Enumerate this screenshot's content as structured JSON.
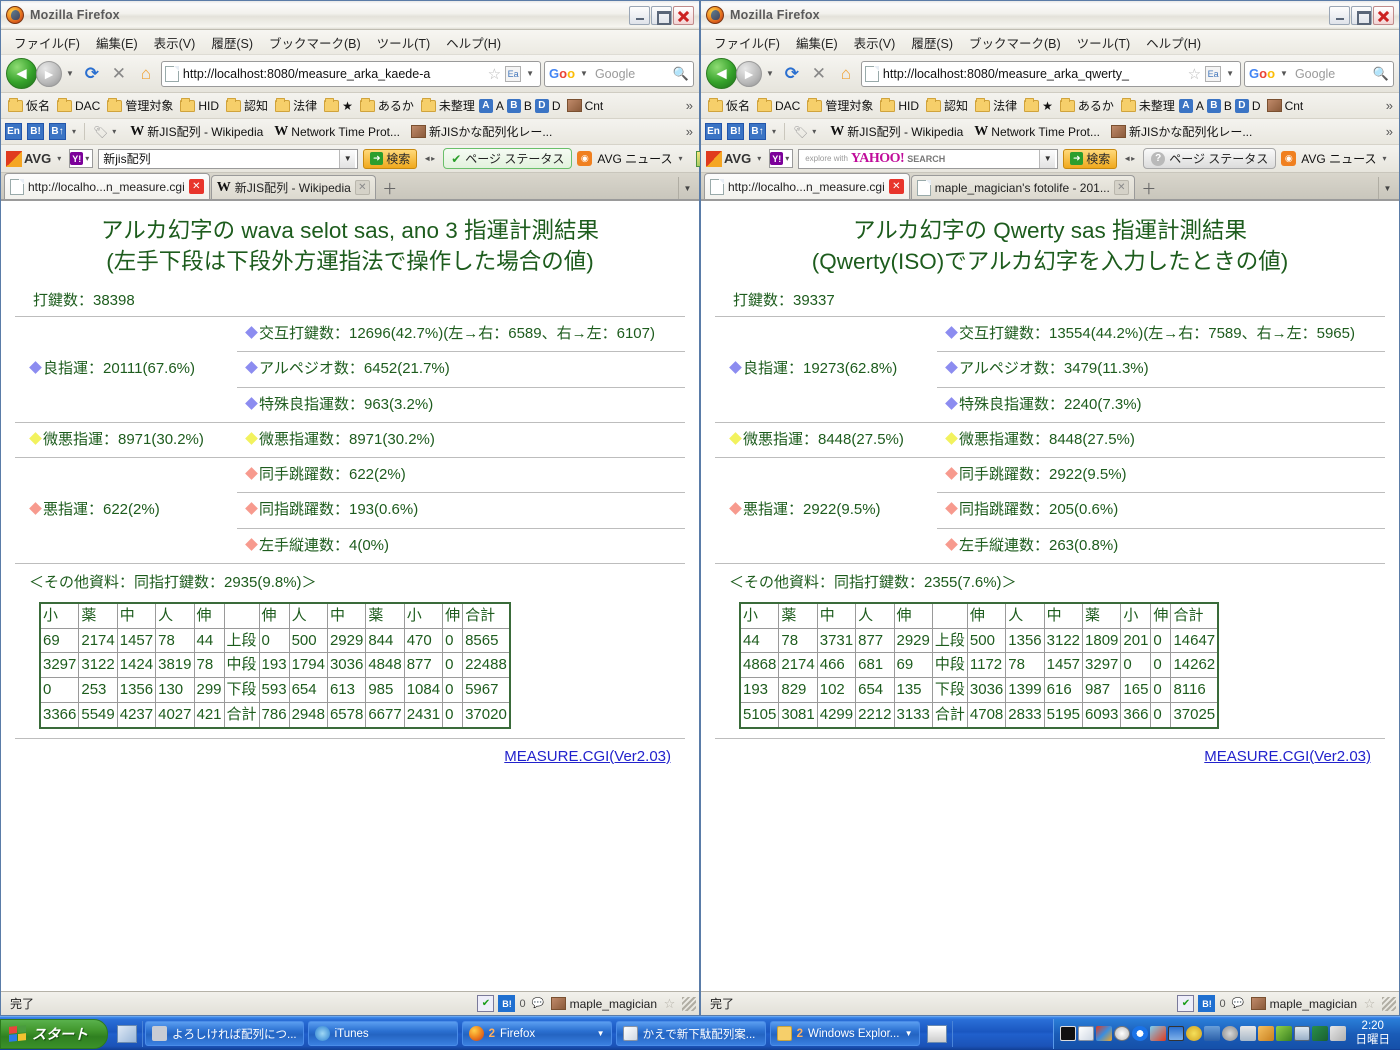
{
  "window": {
    "title": "Mozilla Firefox",
    "buttons": {
      "minimize": "_",
      "maximize": "□",
      "close": "✕"
    }
  },
  "menubar": [
    "ファイル(F)",
    "編集(E)",
    "表示(V)",
    "履歴(S)",
    "ブックマーク(B)",
    "ツール(T)",
    "ヘルプ(H)"
  ],
  "bookmarks_bar": {
    "folders": [
      "仮名",
      "DAC",
      "管理対象",
      "HID",
      "認知",
      "法律",
      "★",
      "あるか",
      "未整理"
    ],
    "chips": [
      "A",
      "A",
      "B",
      "B",
      "D",
      "D"
    ],
    "photo_label": "Cnt",
    "overflow": "»"
  },
  "bookmarks_bar2": {
    "icons": [
      "En",
      "B!",
      "B↑"
    ],
    "tag_arrow": "▾",
    "items": [
      "新JIS配列 - Wikipedia",
      "Network Time Prot...",
      "新JISかな配列化レー..."
    ],
    "overflow": "»"
  },
  "avg_bar": {
    "logo": "AVG",
    "dropdown_arrow": "▾",
    "search_button": "検索",
    "page_status": "ページ ステータス",
    "news": "AVG ニュース",
    "news_arrow": "▾"
  },
  "left": {
    "url": "http://localhost:8080/measure_arka_kaede-a",
    "search_placeholder": "Google",
    "avg_search_value": "新jis配列",
    "tabs": [
      {
        "label": "http://localho...n_measure.cgi",
        "active": true
      },
      {
        "label": "新JIS配列 - Wikipedia",
        "active": false
      }
    ],
    "page": {
      "title_line1": "アルカ幻字の wava selot sas, ano 3 指運計測結果",
      "title_line2": "(左手下段は下段外方運指法で操作した場合の値)",
      "keycount": "打鍵数：38398",
      "rows": [
        {
          "left": "",
          "left_dia": "",
          "right": "交互打鍵数：12696(42.7%)(左→右：6589、右→左：6107)",
          "right_dia": "blue"
        },
        {
          "left": "",
          "left_dia": "",
          "right": "アルペジオ数：6452(21.7%)",
          "right_dia": "blue"
        },
        {
          "left": "良指運：20111(67.6%)",
          "left_dia": "blue",
          "right": "特殊良指運数：963(3.2%)",
          "right_dia": "blue"
        },
        {
          "left": "微悪指運：8971(30.2%)",
          "left_dia": "yellow",
          "right": "微悪指運数：8971(30.2%)",
          "right_dia": "yellow"
        },
        {
          "left": "",
          "left_dia": "",
          "right": "同手跳躍数：622(2%)",
          "right_dia": "red"
        },
        {
          "left": "",
          "left_dia": "",
          "right": "同指跳躍数：193(0.6%)",
          "right_dia": "red"
        },
        {
          "left": "悪指運：622(2%)",
          "left_dia": "red",
          "right": "左手縦連数：4(0%)",
          "right_dia": "red"
        }
      ],
      "note": "＜その他資料：同指打鍵数：2935(9.8%)＞",
      "table": {
        "headers": [
          "小",
          "薬",
          "中",
          "人",
          "伸",
          "",
          "伸",
          "人",
          "中",
          "薬",
          "小",
          "伸",
          "合計"
        ],
        "rows": [
          [
            "69",
            "2174",
            "1457",
            "78",
            "44",
            "上段",
            "0",
            "500",
            "2929",
            "844",
            "470",
            "0",
            "8565"
          ],
          [
            "3297",
            "3122",
            "1424",
            "3819",
            "78",
            "中段",
            "193",
            "1794",
            "3036",
            "4848",
            "877",
            "0",
            "22488"
          ],
          [
            "0",
            "253",
            "1356",
            "130",
            "299",
            "下段",
            "593",
            "654",
            "613",
            "985",
            "1084",
            "0",
            "5967"
          ],
          [
            "3366",
            "5549",
            "4237",
            "4027",
            "421",
            "合計",
            "786",
            "2948",
            "6578",
            "6677",
            "2431",
            "0",
            "37020"
          ]
        ]
      },
      "footer_link": "MEASURE.CGI(Ver2.03)"
    },
    "statusbar": {
      "text": "完了",
      "count": "0",
      "user": "maple_magician"
    }
  },
  "right": {
    "url": "http://localhost:8080/measure_arka_qwerty_",
    "search_placeholder": "Google",
    "avg_search_placeholder": {
      "small": "explore with",
      "brand": "YAHOO!",
      "suffix": "SEARCH"
    },
    "tabs": [
      {
        "label": "http://localho...n_measure.cgi",
        "active": true
      },
      {
        "label": "maple_magician's fotolife - 201...",
        "active": false
      }
    ],
    "page": {
      "title_line1": "アルカ幻字の Qwerty sas 指運計測結果",
      "title_line2": "(Qwerty(ISO)でアルカ幻字を入力したときの値)",
      "keycount": "打鍵数：39337",
      "rows": [
        {
          "left": "",
          "left_dia": "",
          "right": "交互打鍵数：13554(44.2%)(左→右：7589、右→左：5965)",
          "right_dia": "blue"
        },
        {
          "left": "",
          "left_dia": "",
          "right": "アルペジオ数：3479(11.3%)",
          "right_dia": "blue"
        },
        {
          "left": "良指運：19273(62.8%)",
          "left_dia": "blue",
          "right": "特殊良指運数：2240(7.3%)",
          "right_dia": "blue"
        },
        {
          "left": "微悪指運：8448(27.5%)",
          "left_dia": "yellow",
          "right": "微悪指運数：8448(27.5%)",
          "right_dia": "yellow"
        },
        {
          "left": "",
          "left_dia": "",
          "right": "同手跳躍数：2922(9.5%)",
          "right_dia": "red"
        },
        {
          "left": "",
          "left_dia": "",
          "right": "同指跳躍数：205(0.6%)",
          "right_dia": "red"
        },
        {
          "left": "悪指運：2922(9.5%)",
          "left_dia": "red",
          "right": "左手縦連数：263(0.8%)",
          "right_dia": "red"
        }
      ],
      "note": "＜その他資料：同指打鍵数：2355(7.6%)＞",
      "table": {
        "headers": [
          "小",
          "薬",
          "中",
          "人",
          "伸",
          "",
          "伸",
          "人",
          "中",
          "薬",
          "小",
          "伸",
          "合計"
        ],
        "rows": [
          [
            "44",
            "78",
            "3731",
            "877",
            "2929",
            "上段",
            "500",
            "1356",
            "3122",
            "1809",
            "201",
            "0",
            "14647"
          ],
          [
            "4868",
            "2174",
            "466",
            "681",
            "69",
            "中段",
            "1172",
            "78",
            "1457",
            "3297",
            "0",
            "0",
            "14262"
          ],
          [
            "193",
            "829",
            "102",
            "654",
            "135",
            "下段",
            "3036",
            "1399",
            "616",
            "987",
            "165",
            "0",
            "8116"
          ],
          [
            "5105",
            "3081",
            "4299",
            "2212",
            "3133",
            "合計",
            "4708",
            "2833",
            "5195",
            "6093",
            "366",
            "0",
            "37025"
          ]
        ]
      },
      "footer_link": "MEASURE.CGI(Ver2.03)"
    },
    "statusbar": {
      "text": "完了",
      "count": "0",
      "user": "maple_magician"
    }
  },
  "taskbar": {
    "start": "スタート",
    "buttons": [
      {
        "label": "よろしければ配列につ...",
        "count": "",
        "caret": ""
      },
      {
        "label": "iTunes",
        "count": "",
        "caret": ""
      },
      {
        "label": "Firefox",
        "count": "2",
        "caret": "▼"
      },
      {
        "label": "かえで新下駄配列案...",
        "count": "",
        "caret": ""
      },
      {
        "label": "Windows Explor...",
        "count": "2",
        "caret": "▼"
      }
    ],
    "clock_time": "2:20",
    "clock_day": "日曜日"
  },
  "colors": {
    "page_text": "#1d5c1d",
    "link": "#2222cc",
    "good_diamond": "#8c8cf0",
    "mid_diamond": "#f2f25e",
    "bad_diamond": "#f79a8e",
    "table_border": "#3a6b3a"
  }
}
